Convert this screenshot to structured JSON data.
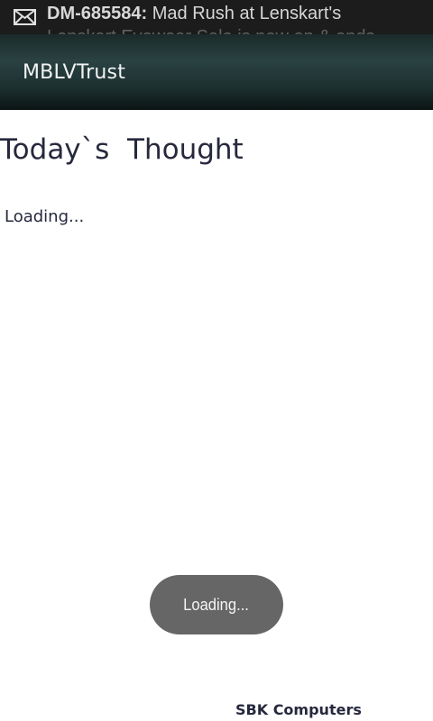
{
  "status_bar": {
    "notification_icon": "mail-icon",
    "notification_id": "DM-685584:",
    "notification_text": " Mad Rush at Lenskart's",
    "notification_next_line": "Lenskart Eyewear Sale is now on & ends"
  },
  "action_bar": {
    "title": "MBLVTrust",
    "background": "#1d3030"
  },
  "main": {
    "heading": "Today`s  Thought",
    "loading": "Loading..."
  },
  "toast": {
    "text": "Loading..."
  },
  "footer": {
    "text": "SBK Computers"
  }
}
